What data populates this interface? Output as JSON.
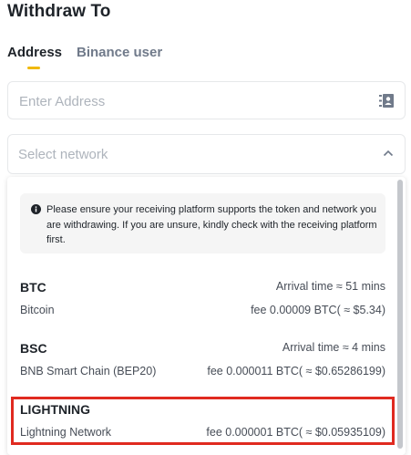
{
  "page": {
    "title": "Withdraw To"
  },
  "tabs": [
    {
      "label": "Address",
      "active": true
    },
    {
      "label": "Binance user",
      "active": false
    }
  ],
  "address": {
    "placeholder": "Enter Address",
    "value": "",
    "icon": "address-book-icon"
  },
  "network_select": {
    "placeholder": "Select network",
    "icon": "chevron-up-icon",
    "expanded": true
  },
  "notice": {
    "icon": "info-icon",
    "text": "Please ensure your receiving platform supports the token and network you are withdrawing. If you are unsure, kindly check with the receiving platform first."
  },
  "networks": [
    {
      "code": "BTC",
      "name": "Bitcoin",
      "arrival": "Arrival time ≈ 51 mins",
      "fee": "fee 0.00009 BTC( ≈ $5.34)",
      "highlighted": false
    },
    {
      "code": "BSC",
      "name": "BNB Smart Chain (BEP20)",
      "arrival": "Arrival time ≈ 4 mins",
      "fee": "fee 0.000011 BTC( ≈ $0.65286199)",
      "highlighted": false
    },
    {
      "code": "LIGHTNING",
      "name": "Lightning Network",
      "arrival": "",
      "fee": "fee 0.000001 BTC( ≈ $0.05935109)",
      "highlighted": true
    }
  ],
  "colors": {
    "accent": "#f0b90b",
    "highlight": "#e02a20",
    "text_primary": "#1e2329",
    "text_secondary": "#474d57",
    "placeholder": "#aeb4bc"
  }
}
